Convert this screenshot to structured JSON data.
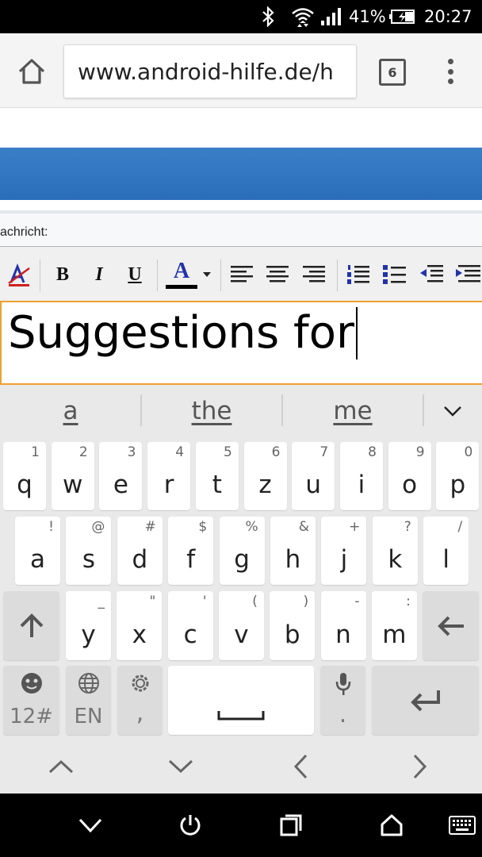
{
  "status_bar": {
    "battery_percent": "41%",
    "time": "20:27",
    "icons": [
      "bluetooth-icon",
      "wifi-icon",
      "signal-icon",
      "battery-charging-icon"
    ]
  },
  "browser": {
    "url": "www.android-hilfe.de/h",
    "tab_count": "6",
    "icons": [
      "home-icon",
      "tab-switcher-icon",
      "overflow-menu-icon"
    ]
  },
  "page": {
    "message_label": "achricht:",
    "editor_toolbar": {
      "bold": "B",
      "italic": "I",
      "underline": "U",
      "font_color": "A",
      "icons": [
        "remove-format-icon",
        "font-color-icon",
        "align-left-icon",
        "align-center-icon",
        "align-right-icon",
        "ordered-list-icon",
        "unordered-list-icon",
        "outdent-icon",
        "indent-icon"
      ]
    },
    "editor_text": "Suggestions for"
  },
  "keyboard": {
    "suggestions": [
      "a",
      "the",
      "me"
    ],
    "row1": [
      {
        "key": "q",
        "hint": "1"
      },
      {
        "key": "w",
        "hint": "2"
      },
      {
        "key": "e",
        "hint": "3"
      },
      {
        "key": "r",
        "hint": "4"
      },
      {
        "key": "t",
        "hint": "5"
      },
      {
        "key": "z",
        "hint": "6"
      },
      {
        "key": "u",
        "hint": "7"
      },
      {
        "key": "i",
        "hint": "8"
      },
      {
        "key": "o",
        "hint": "9"
      },
      {
        "key": "p",
        "hint": "0"
      }
    ],
    "row2": [
      {
        "key": "a",
        "hint": "!"
      },
      {
        "key": "s",
        "hint": "@"
      },
      {
        "key": "d",
        "hint": "#"
      },
      {
        "key": "f",
        "hint": "$"
      },
      {
        "key": "g",
        "hint": "%"
      },
      {
        "key": "h",
        "hint": "&"
      },
      {
        "key": "j",
        "hint": "+"
      },
      {
        "key": "k",
        "hint": "?"
      },
      {
        "key": "l",
        "hint": "/"
      }
    ],
    "row3": [
      {
        "key": "y",
        "hint": "_"
      },
      {
        "key": "x",
        "hint": "\""
      },
      {
        "key": "c",
        "hint": "'"
      },
      {
        "key": "v",
        "hint": "("
      },
      {
        "key": "b",
        "hint": ")"
      },
      {
        "key": "n",
        "hint": "-"
      },
      {
        "key": "m",
        "hint": ":"
      }
    ],
    "bottom_row": {
      "symbols_label": "12#",
      "language_label": "EN",
      "comma_label": ",",
      "period_label": "."
    }
  },
  "nav_bar": {
    "icons": [
      "hide-keyboard-icon",
      "power-icon",
      "recents-icon",
      "home-icon",
      "keyboard-icon"
    ]
  }
}
